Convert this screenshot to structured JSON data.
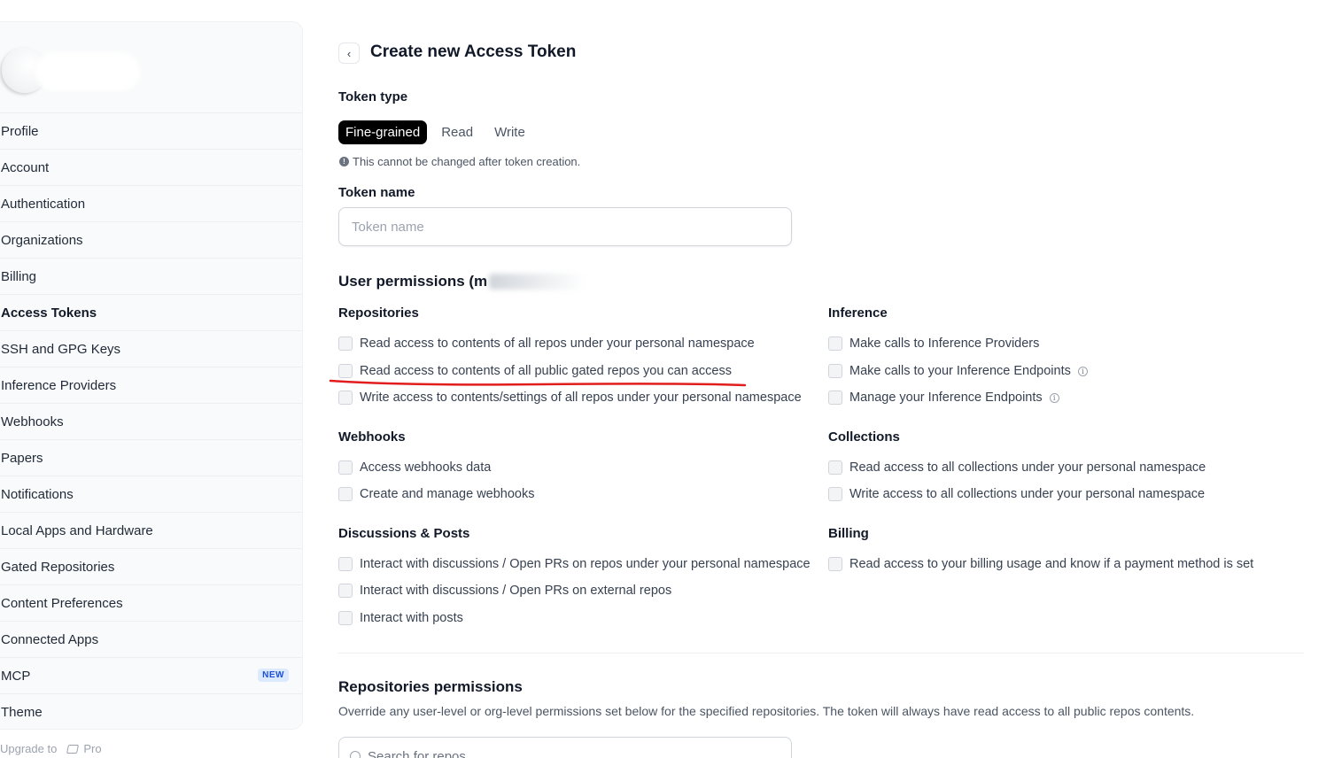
{
  "sidebar": {
    "items": [
      {
        "label": "Profile"
      },
      {
        "label": "Account"
      },
      {
        "label": "Authentication"
      },
      {
        "label": "Organizations"
      },
      {
        "label": "Billing"
      },
      {
        "label": "Access Tokens",
        "active": true
      },
      {
        "label": "SSH and GPG Keys"
      },
      {
        "label": "Inference Providers"
      },
      {
        "label": "Webhooks"
      },
      {
        "label": "Papers"
      },
      {
        "label": "Notifications"
      },
      {
        "label": "Local Apps and Hardware"
      },
      {
        "label": "Gated Repositories"
      },
      {
        "label": "Content Preferences"
      },
      {
        "label": "Connected Apps"
      },
      {
        "label": "MCP",
        "badge": "NEW"
      },
      {
        "label": "Theme"
      }
    ],
    "upgrade_text": "Upgrade to",
    "upgrade_plan": "Pro"
  },
  "header": {
    "back_icon": "chevron-left-icon",
    "title": "Create new Access Token"
  },
  "token_type": {
    "label": "Token type",
    "options": [
      "Fine-grained",
      "Read",
      "Write"
    ],
    "selected": "Fine-grained",
    "note": "This cannot be changed after token creation."
  },
  "token_name": {
    "label": "Token name",
    "placeholder": "Token name",
    "value": ""
  },
  "user_permissions": {
    "title": "User permissions (m"
  },
  "sections": {
    "repositories": {
      "title": "Repositories",
      "items": [
        "Read access to contents of all repos under your personal namespace",
        "Read access to contents of all public gated repos you can access",
        "Write access to contents/settings of all repos under your personal namespace"
      ]
    },
    "inference": {
      "title": "Inference",
      "items": [
        "Make calls to Inference Providers",
        "Make calls to your Inference Endpoints",
        "Manage your Inference Endpoints"
      ]
    },
    "webhooks": {
      "title": "Webhooks",
      "items": [
        "Access webhooks data",
        "Create and manage webhooks"
      ]
    },
    "collections": {
      "title": "Collections",
      "items": [
        "Read access to all collections under your personal namespace",
        "Write access to all collections under your personal namespace"
      ]
    },
    "discussions": {
      "title": "Discussions & Posts",
      "items": [
        "Interact with discussions / Open PRs on repos under your personal namespace",
        "Interact with discussions / Open PRs on external repos",
        "Interact with posts"
      ]
    },
    "billing": {
      "title": "Billing",
      "items": [
        "Read access to your billing usage and know if a payment method is set"
      ]
    }
  },
  "annotation": {
    "color": "#e11d1d",
    "target": "Read access to contents of all public gated repos you can access"
  },
  "repo_permissions": {
    "title": "Repositories permissions",
    "description": "Override any user-level or org-level permissions set below for the specified repositories. The token will always have read access to all public repos contents.",
    "search_placeholder": "Search for repos"
  }
}
